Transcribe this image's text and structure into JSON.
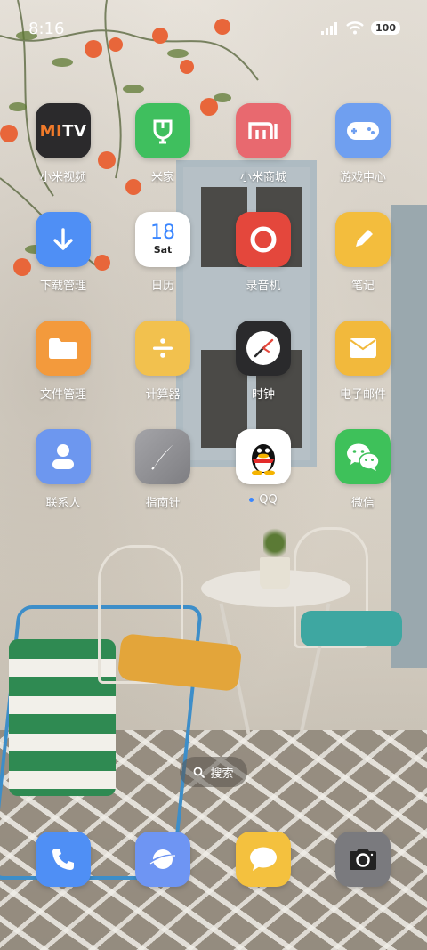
{
  "status_bar": {
    "time": "8:16",
    "battery": "100"
  },
  "apps": [
    {
      "label": "小米视频",
      "icon": "mitv-icon",
      "text": "MITV",
      "color": "#2b2a2c"
    },
    {
      "label": "米家",
      "icon": "mijia-icon",
      "color": "#3fbf5e"
    },
    {
      "label": "小米商城",
      "icon": "mi-store-icon",
      "color": "#e8696f"
    },
    {
      "label": "游戏中心",
      "icon": "gamepad-icon",
      "color": "#6f9ff0"
    },
    {
      "label": "下载管理",
      "icon": "download-icon",
      "color": "#4f8ff5"
    },
    {
      "label": "日历",
      "icon": "calendar-icon",
      "day": "18",
      "weekday": "Sat",
      "color": "#ffffff"
    },
    {
      "label": "录音机",
      "icon": "recorder-icon",
      "color": "#e4473c"
    },
    {
      "label": "笔记",
      "icon": "notes-icon",
      "color": "#f3bd3d"
    },
    {
      "label": "文件管理",
      "icon": "folder-icon",
      "color": "#f39a3c"
    },
    {
      "label": "计算器",
      "icon": "calculator-icon",
      "color": "#f2c14e"
    },
    {
      "label": "时钟",
      "icon": "clock-icon",
      "color": "#2a2a2c"
    },
    {
      "label": "电子邮件",
      "icon": "mail-icon",
      "color": "#f2b93c"
    },
    {
      "label": "联系人",
      "icon": "contacts-icon",
      "color": "#6d97ef"
    },
    {
      "label": "指南针",
      "icon": "compass-icon",
      "color": "#8f8f93"
    },
    {
      "label": "QQ",
      "icon": "qq-icon",
      "color": "#ffffff",
      "new": true
    },
    {
      "label": "微信",
      "icon": "wechat-icon",
      "color": "#3ec15a"
    }
  ],
  "search": {
    "label": "搜索"
  },
  "dock": [
    {
      "icon": "phone-icon",
      "color": "#4f8ff5"
    },
    {
      "icon": "browser-icon",
      "color": "#6e95f3"
    },
    {
      "icon": "messages-icon",
      "color": "#f4c13e"
    },
    {
      "icon": "camera-icon",
      "color": "#7a7a7e"
    }
  ]
}
